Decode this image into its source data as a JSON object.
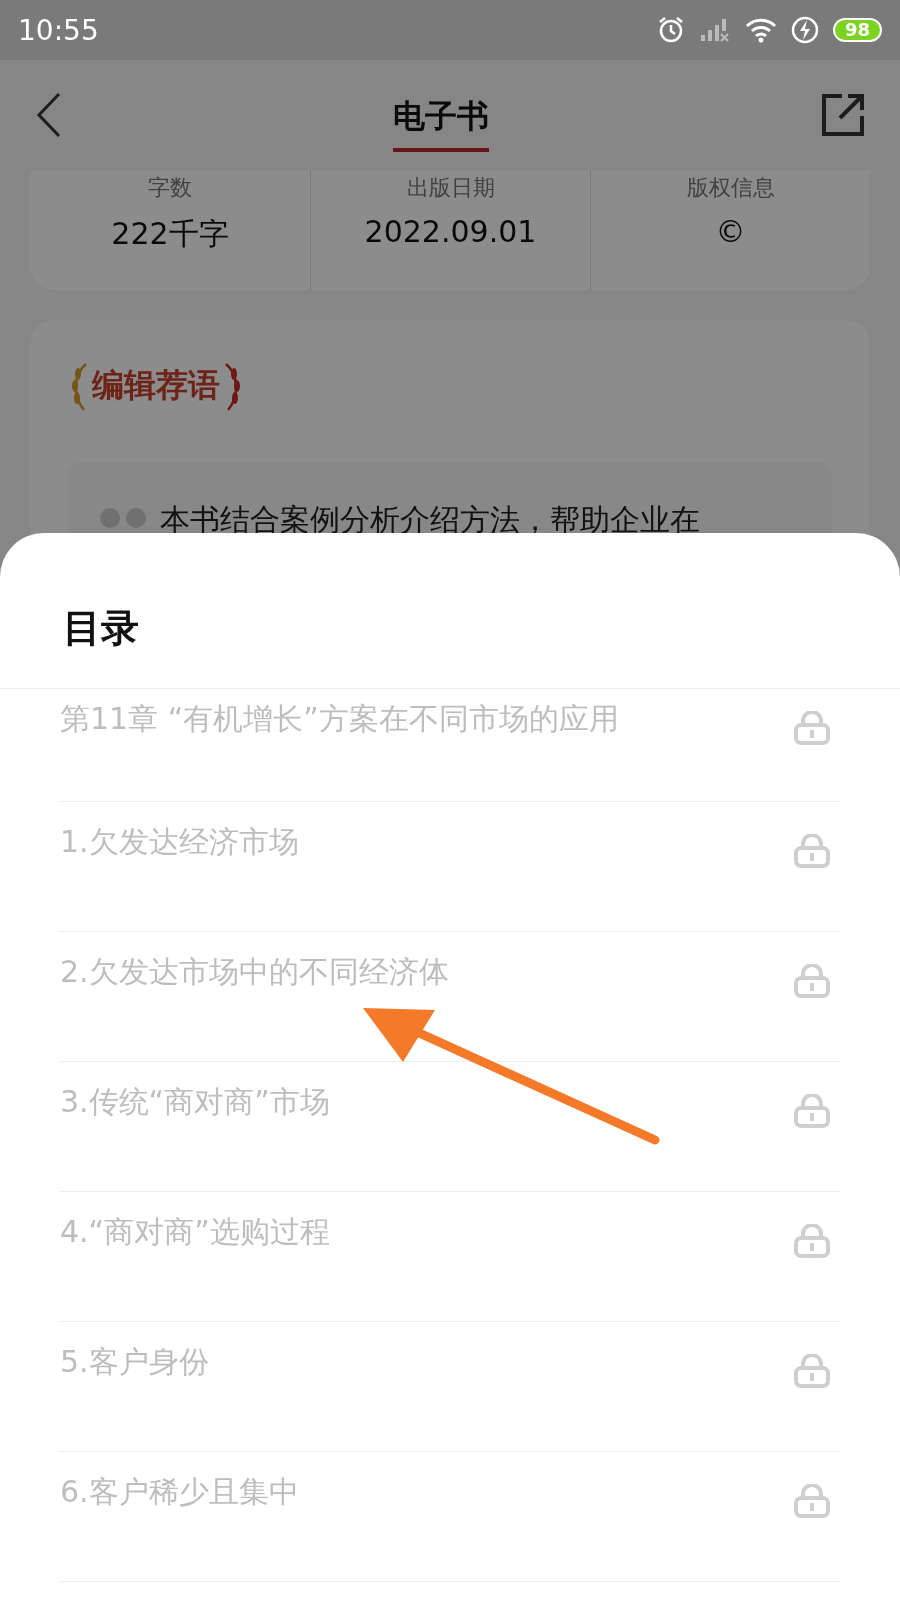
{
  "status_bar": {
    "time": "10:55",
    "battery": "98"
  },
  "header": {
    "title": "电子书",
    "selected": true
  },
  "stats": [
    {
      "label": "字数",
      "value": "222千字",
      "kind": "text"
    },
    {
      "label": "出版日期",
      "value": "2022.09.01",
      "kind": "text"
    },
    {
      "label": "版权信息",
      "value": "©",
      "kind": "text"
    }
  ],
  "recommendation": {
    "title": "编辑荐语",
    "quote": "本书结合案例分析介绍方法，帮助企业在"
  },
  "sheet": {
    "title": "目录",
    "items": [
      {
        "label": "第11章 “有机增长”方案在不同市场的应用",
        "locked": true
      },
      {
        "label": "1.欠发达经济市场",
        "locked": true
      },
      {
        "label": "2.欠发达市场中的不同经济体",
        "locked": true
      },
      {
        "label": "3.传统“商对商”市场",
        "locked": true
      },
      {
        "label": "4.“商对商”选购过程",
        "locked": true
      },
      {
        "label": "5.客户身份",
        "locked": true
      },
      {
        "label": "6.客户稀少且集中",
        "locked": true
      }
    ]
  }
}
